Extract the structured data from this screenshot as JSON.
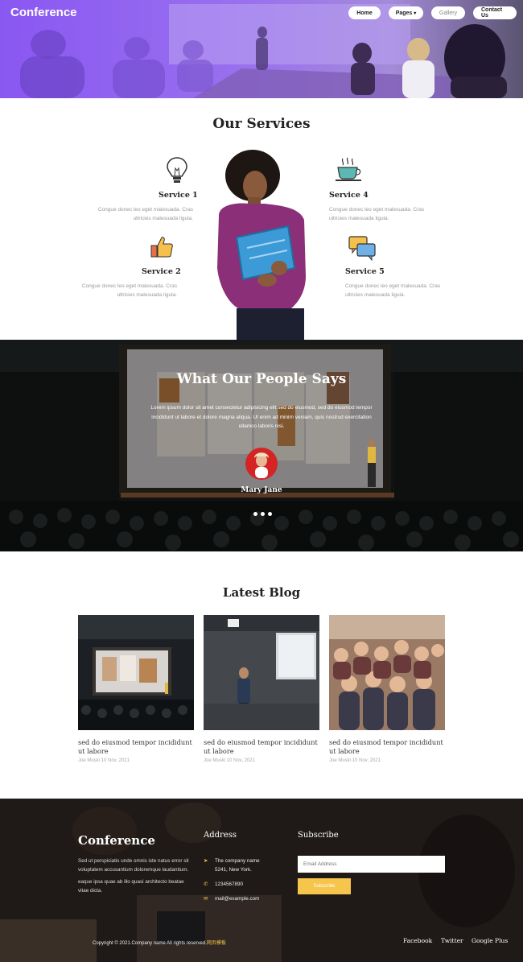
{
  "header": {
    "brand": "Conference",
    "nav": [
      {
        "label": "Home"
      },
      {
        "label": "Pages"
      },
      {
        "label": "Gallery"
      },
      {
        "label": "Contact Us"
      }
    ],
    "nav_pages_caret": "▾"
  },
  "services": {
    "title": "Our Services",
    "items": [
      {
        "title": "Service 1",
        "desc": "Congue donec leo eget malesuada. Cras ultricies malesuada ligula.",
        "icon": "lightbulb-icon"
      },
      {
        "title": "Service 2",
        "desc": "Congue donec leo eget malesuada. Cras ultricies malesuada ligula.",
        "icon": "thumbs-up-icon"
      },
      {
        "title": "Service 4",
        "desc": "Congue donec leo eget malesuada. Cras ultricies malesuada ligula.",
        "icon": "coffee-cup-icon"
      },
      {
        "title": "Service 5",
        "desc": "Congue donec leo eget malesuada. Cras ultricies malesuada ligula.",
        "icon": "chat-bubbles-icon"
      }
    ]
  },
  "testimonial": {
    "title": "What Our People Says",
    "text": "Lorem ipsum dolor sit amet consectetur adipisicing elit sed do eiusmod, sed do eiusmod tempor incididunt ut labore et dolore magna aliqua. Ut enim ad minim veniam, quis nostrud exercitation ullamco laboris nisi.",
    "name": "Mary Jane",
    "slides": 3
  },
  "blog": {
    "title": "Latest Blog",
    "posts": [
      {
        "title": "sed do eiusmod tempor incididunt ut labore",
        "meta": "Joe Muski 10 Nov, 2021"
      },
      {
        "title": "sed do eiusmod tempor incididunt ut labore",
        "meta": "Joe Muski 10 Nov, 2021"
      },
      {
        "title": "sed do eiusmod tempor incididunt ut labore",
        "meta": "Joe Muski 10 Nov, 2021"
      }
    ]
  },
  "footer": {
    "brand": "Conference",
    "about_1": "Sed ut perspiciatis unde omnis iste natus error sit voluptatem accusantium doloremque laudantium.",
    "about_2": "eaque ipsa quae ab illo quasi architecto beatae vitae dicta.",
    "address_heading": "Address",
    "address_line1": "The company name",
    "address_line2": "5241, New York.",
    "phone": "1234567890",
    "email": "mail@example.com",
    "subscribe_heading": "Subscribe",
    "email_placeholder": "Email Address",
    "subscribe_button": "Subscribe",
    "copyright": "Copyright © 2021.Company name All rights reserved.",
    "copyright_highlight": "网页模板",
    "social": [
      "Facebook",
      "Twitter",
      "Google Plus"
    ]
  },
  "colors": {
    "accent": "#f6c54c",
    "hero_purple": "#8e5cf0",
    "footer_bg": "#2a2520"
  }
}
